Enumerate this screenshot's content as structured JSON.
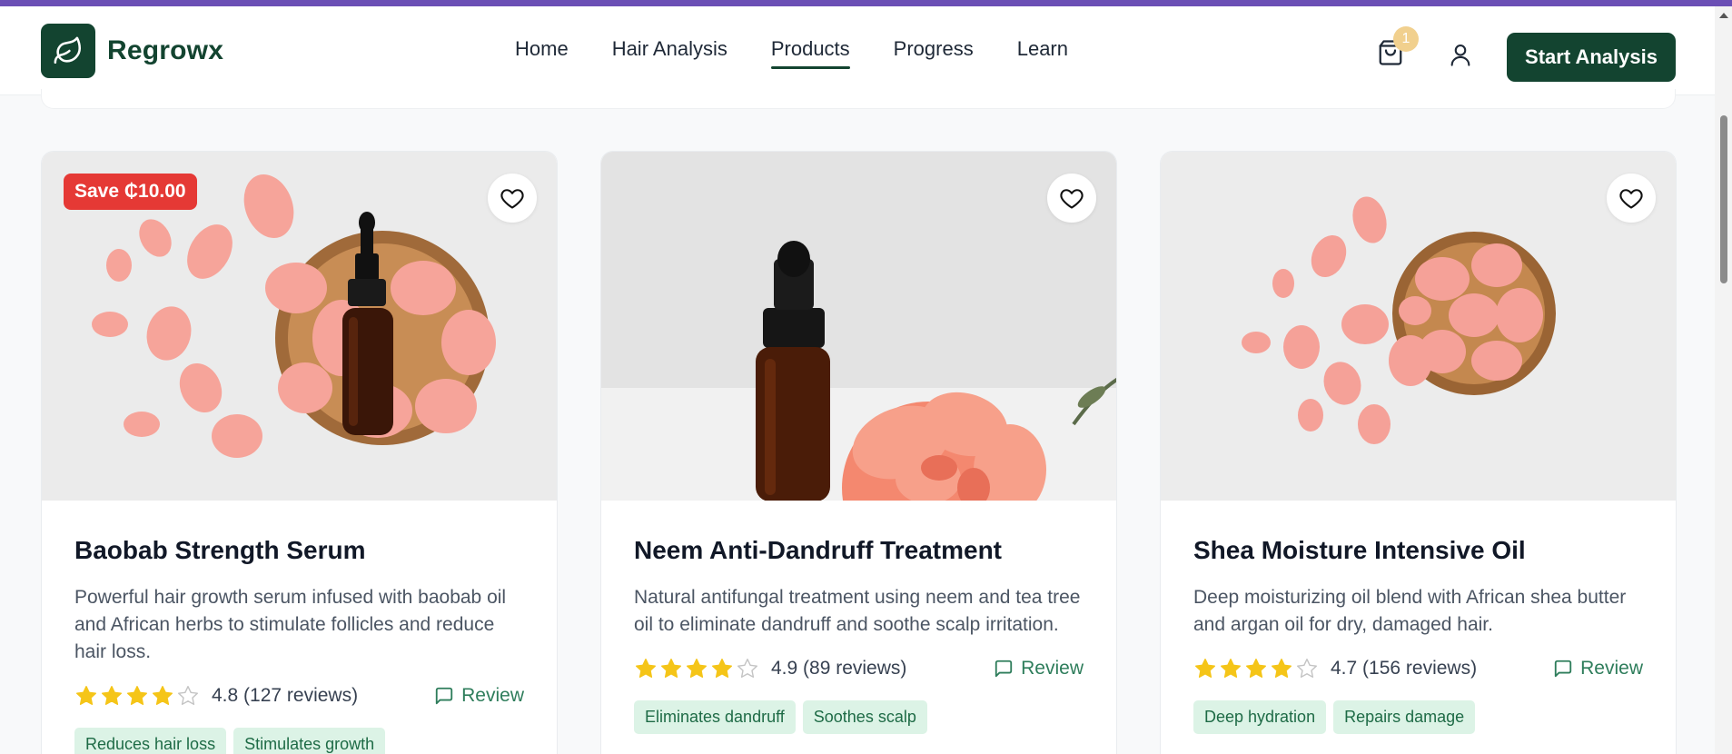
{
  "brand": {
    "name": "Regrowx",
    "logo_icon": "leaf-icon"
  },
  "nav": {
    "links": [
      {
        "label": "Home"
      },
      {
        "label": "Hair Analysis"
      },
      {
        "label": "Products"
      },
      {
        "label": "Progress"
      },
      {
        "label": "Learn"
      }
    ],
    "active": "Products"
  },
  "header": {
    "cart_count": "1",
    "cta_label": "Start Analysis"
  },
  "colors": {
    "brand": "#134430",
    "accent_bar": "#6b4fb5",
    "sale": "#e53935",
    "star": "#f5c518",
    "tag_bg": "#dcf3e6",
    "review": "#2e7d5b"
  },
  "products": [
    {
      "save_label": "Save ₵10.00",
      "title": "Baobab Strength Serum",
      "description": "Powerful hair growth serum infused with baobab oil and African herbs to stimulate follicles and reduce hair loss.",
      "rating": 4.8,
      "rating_text": "4.8 (127 reviews)",
      "filled_stars": 4,
      "review_label": "Review",
      "tags": [
        "Reduces hair loss",
        "Stimulates growth"
      ]
    },
    {
      "title": "Neem Anti-Dandruff Treatment",
      "description": "Natural antifungal treatment using neem and tea tree oil to eliminate dandruff and soothe scalp irritation.",
      "rating": 4.9,
      "rating_text": "4.9 (89 reviews)",
      "filled_stars": 4,
      "review_label": "Review",
      "tags": [
        "Eliminates dandruff",
        "Soothes scalp"
      ]
    },
    {
      "title": "Shea Moisture Intensive Oil",
      "description": "Deep moisturizing oil blend with African shea butter and argan oil for dry, damaged hair.",
      "rating": 4.7,
      "rating_text": "4.7 (156 reviews)",
      "filled_stars": 4,
      "review_label": "Review",
      "tags": [
        "Deep hydration",
        "Repairs damage"
      ]
    }
  ]
}
